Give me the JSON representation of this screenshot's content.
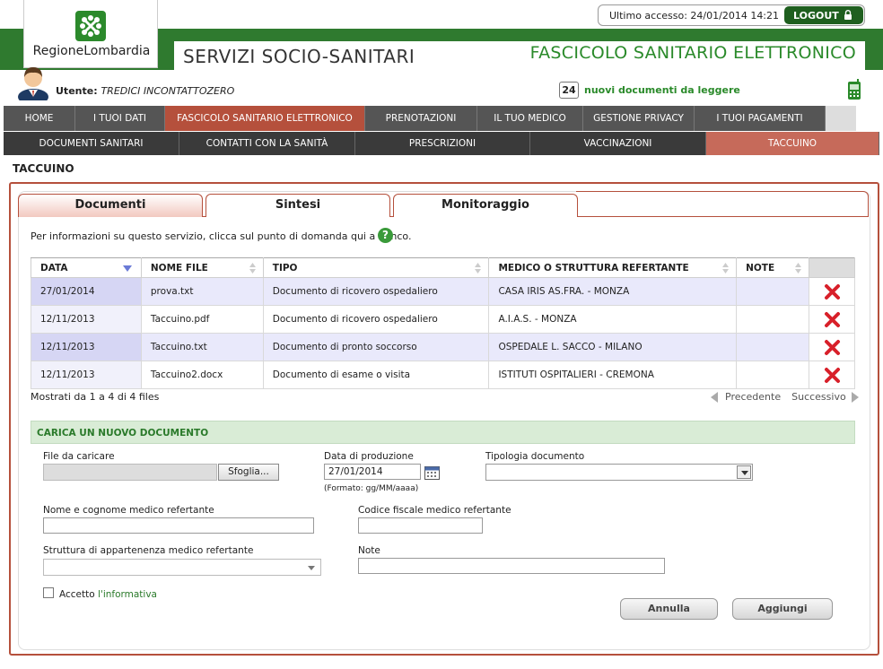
{
  "header": {
    "logo_text": "RegioneLombardia",
    "last_access": "Ultimo accesso: 24/01/2014 14:21",
    "logout_label": "LOGOUT",
    "title_left": "SERVIZI SOCIO-SANITARI",
    "title_right": "FASCICOLO SANITARIO ELETTRONICO",
    "user_label": "Utente:",
    "user_name": "TREDICI INCONTATTOZERO",
    "new_docs_count": "24",
    "new_docs_text": "nuovi documenti da leggere"
  },
  "nav_main": [
    {
      "label": "HOME"
    },
    {
      "label": "I TUOI DATI"
    },
    {
      "label": "FASCICOLO SANITARIO ELETTRONICO"
    },
    {
      "label": "PRENOTAZIONI"
    },
    {
      "label": "IL TUO MEDICO"
    },
    {
      "label": "GESTIONE PRIVACY"
    },
    {
      "label": "I TUOI PAGAMENTI"
    }
  ],
  "nav_sub": [
    {
      "label": "DOCUMENTI SANITARI"
    },
    {
      "label": "CONTATTI CON LA SANITÀ"
    },
    {
      "label": "PRESCRIZIONI"
    },
    {
      "label": "VACCINAZIONI"
    },
    {
      "label": "TACCUINO"
    }
  ],
  "section_title": "TACCUINO",
  "tabs": [
    {
      "label": "Documenti"
    },
    {
      "label": "Sintesi"
    },
    {
      "label": "Monitoraggio"
    }
  ],
  "info_text": "Per informazioni su questo servizio, clicca sul punto di domanda qui a fianco.",
  "help_glyph": "?",
  "table": {
    "headers": [
      "DATA",
      "NOME FILE",
      "TIPO",
      "MEDICO O STRUTTURA REFERTANTE",
      "NOTE"
    ],
    "rows": [
      {
        "date": "27/01/2014",
        "file": "prova.txt",
        "type": "Documento di ricovero ospedaliero",
        "doctor": "CASA IRIS AS.FRA. - MONZA",
        "note": ""
      },
      {
        "date": "12/11/2013",
        "file": "Taccuino.pdf",
        "type": "Documento di ricovero ospedaliero",
        "doctor": "A.I.A.S. - MONZA",
        "note": ""
      },
      {
        "date": "12/11/2013",
        "file": "Taccuino.txt",
        "type": "Documento di pronto soccorso",
        "doctor": "OSPEDALE L. SACCO - MILANO",
        "note": ""
      },
      {
        "date": "12/11/2013",
        "file": "Taccuino2.docx",
        "type": "Documento di esame o visita",
        "doctor": "ISTITUTI OSPITALIERI - CREMONA",
        "note": ""
      }
    ],
    "shown_text": "Mostrati da 1 a 4 di 4 files",
    "prev_label": "Precedente",
    "next_label": "Successivo"
  },
  "upload": {
    "heading": "CARICA UN NUOVO DOCUMENTO",
    "file_label": "File da caricare",
    "browse_label": "Sfoglia...",
    "date_label": "Data di produzione",
    "date_value": "27/01/2014",
    "date_format_note": "(Formato: gg/MM/aaaa)",
    "type_label": "Tipologia documento",
    "type_value": "",
    "doctor_name_label": "Nome e cognome medico refertante",
    "doctor_name_value": "",
    "doctor_cf_label": "Codice fiscale medico refertante",
    "doctor_cf_value": "",
    "structure_label": "Struttura di appartenenza medico refertante",
    "structure_value": "",
    "note_label": "Note",
    "note_value": "",
    "accept_prefix": "Accetto",
    "accept_link": "l'informativa",
    "cancel_label": "Annulla",
    "add_label": "Aggiungi"
  },
  "colors": {
    "brand_green": "#2f7a2f",
    "accent_red": "#b5503c",
    "menu_dark": "#555555"
  }
}
